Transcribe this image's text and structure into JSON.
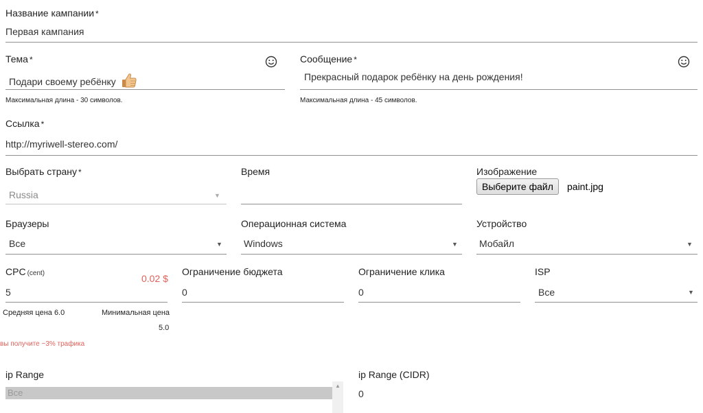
{
  "campaign": {
    "label": "Название кампании",
    "required": "*",
    "value": "Первая кампания"
  },
  "topic": {
    "label": "Тема",
    "required": "*",
    "value": "Подари своему ребёнку",
    "hint": "Максимальная длина - 30 символов."
  },
  "message": {
    "label": "Сообщение",
    "required": "*",
    "value": "Прекрасный подарок ребёнку на день рождения!",
    "hint": "Максимальная длина - 45 символов."
  },
  "link": {
    "label": "Ссылка",
    "required": "*",
    "value": "http://myriwell-stereo.com/"
  },
  "country": {
    "label": "Выбрать страну",
    "required": "*",
    "value": "Russia"
  },
  "time": {
    "label": "Время",
    "value": ""
  },
  "image": {
    "label": "Изображение",
    "button": "Выберите файл",
    "filename": "paint.jpg"
  },
  "browsers": {
    "label": "Браузеры",
    "value": "Все"
  },
  "os": {
    "label": "Операционная система",
    "value": "Windows"
  },
  "device": {
    "label": "Устройство",
    "value": "Мобайл"
  },
  "cpc": {
    "label": "CPC",
    "unit": "(cent)",
    "value": "5",
    "price": "0.02 $",
    "avg": "Средняя цена 6.0",
    "min_label": "Минимальная цена",
    "min_value": "5.0",
    "traffic": "вы получите ~3% трафика"
  },
  "budget": {
    "label": "Ограничение бюджета",
    "value": "0"
  },
  "click": {
    "label": "Ограничение клика",
    "value": "0"
  },
  "isp": {
    "label": "ISP",
    "value": "Все"
  },
  "iprange": {
    "label": "ip Range",
    "selected": "Все"
  },
  "ipcidr": {
    "label": "ip Range (CIDR)",
    "value": "0"
  },
  "colors": {
    "accent_red": "#e0605a",
    "line": "#8f8f8f",
    "list_selected": "#c8c8c8"
  }
}
